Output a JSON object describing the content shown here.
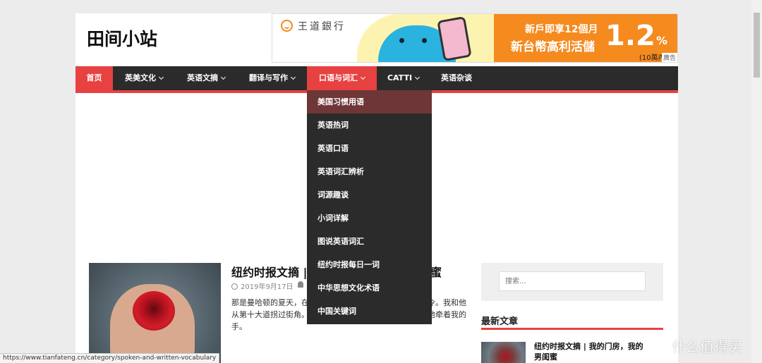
{
  "site": {
    "title": "田间小站"
  },
  "ad": {
    "bank_name": "王道銀行",
    "line1": "新戶即享12個月",
    "line2": "新台幣高利活儲",
    "rate": "1.2",
    "percent": "%",
    "line3": "(10萬內)",
    "tag": "廣告"
  },
  "nav": {
    "items": [
      {
        "label": "首页"
      },
      {
        "label": "英美文化"
      },
      {
        "label": "英语文摘"
      },
      {
        "label": "翻译与写作"
      },
      {
        "label": "口语与词汇"
      },
      {
        "label": "CATTI"
      },
      {
        "label": "英语杂谈"
      }
    ]
  },
  "dropdown": {
    "items": [
      "美国习惯用语",
      "英语热词",
      "英语口语",
      "英语词汇辨析",
      "词源趣谈",
      "小词详解",
      "图说英语词汇",
      "纽约时报每日一词",
      "中华思想文化术语",
      "中国关键词"
    ]
  },
  "post": {
    "title": "纽约时报文摘 |",
    "title_tail": "蜜",
    "date": "2019年9月17日",
    "excerpt_l1a": "那是曼哈顿的夏天，在",
    "excerpt_l1b": "令。我和他",
    "excerpt_l2a": "从第十大道拐过街角。",
    "excerpt_l2b": "他牵着我的",
    "excerpt_l3": "手。"
  },
  "sidebar": {
    "search_placeholder": "搜索...",
    "widget_title": "最新文章",
    "recent_title_l1": "纽约时报文摘 | 我的门房，我的",
    "recent_title_l2": "男闺蜜"
  },
  "statusbar": {
    "url": "https://www.tianfateng.cn/category/spoken-and-written-vocabulary"
  },
  "watermark": {
    "text": "什么值得买",
    "icon_char": "值"
  },
  "colors": {
    "accent": "#e84141",
    "nav_bg": "#2b2b2b",
    "dropdown_hover": "#6e3637"
  }
}
